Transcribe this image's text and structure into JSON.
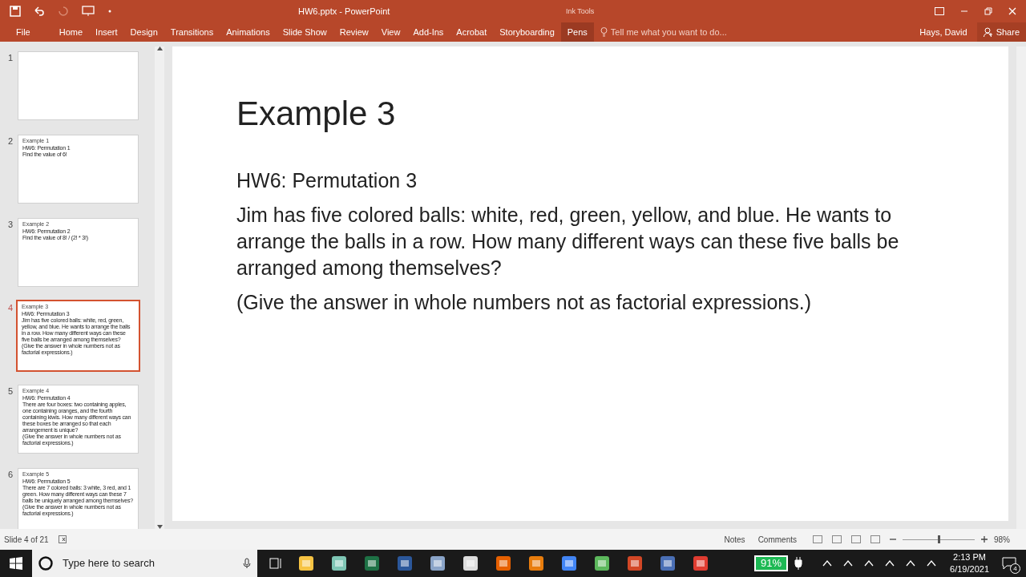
{
  "title_bar": {
    "title": "HW6.pptx - PowerPoint",
    "context_label": "Ink Tools"
  },
  "ribbon": {
    "tabs": [
      {
        "label": "File",
        "selected": false
      },
      {
        "label": "Home",
        "selected": false
      },
      {
        "label": "Insert",
        "selected": false
      },
      {
        "label": "Design",
        "selected": false
      },
      {
        "label": "Transitions",
        "selected": false
      },
      {
        "label": "Animations",
        "selected": false
      },
      {
        "label": "Slide Show",
        "selected": false
      },
      {
        "label": "Review",
        "selected": false
      },
      {
        "label": "View",
        "selected": false
      },
      {
        "label": "Add-Ins",
        "selected": false
      },
      {
        "label": "Acrobat",
        "selected": false
      },
      {
        "label": "Storyboarding",
        "selected": false
      },
      {
        "label": "Pens",
        "selected": true
      }
    ],
    "tell_me": "Tell me what you want to do...",
    "user": "Hays, David",
    "share": "Share"
  },
  "thumbnails": [
    {
      "number": "1",
      "selected": false
    },
    {
      "number": "2",
      "selected": false,
      "title": "Example 1",
      "lines": [
        "HW6: Permutation 1",
        "Find the value of 6!"
      ]
    },
    {
      "number": "3",
      "selected": false,
      "title": "Example 2",
      "lines": [
        "HW6: Permutation 2",
        "Find the value of 8! / (2! * 3!)"
      ]
    },
    {
      "number": "4",
      "selected": true,
      "title": "Example 3",
      "lines": [
        "HW6: Permutation 3",
        "Jim has five colored balls: white, red, green, yellow, and blue. He wants to arrange the balls in a row. How many different ways can these five balls be arranged among themselves?",
        "(Give the answer in whole numbers not as factorial expressions.)"
      ]
    },
    {
      "number": "5",
      "selected": false,
      "title": "Example 4",
      "lines": [
        "HW6: Permutation 4",
        "There are four boxes: two containing apples, one containing oranges, and the fourth containing kiwis. How many different ways can these boxes be arranged so that each arrangement is unique?",
        "(Give the answer in whole numbers not as factorial expressions.)"
      ]
    },
    {
      "number": "6",
      "selected": false,
      "title": "Example 5",
      "lines": [
        "HW6: Permutation 5",
        "There are 7 colored balls: 3 white, 3 red, and 1 green. How many different ways can these 7 balls be uniquely arranged among themselves?",
        "(Give the answer in whole numbers not as factorial expressions.)"
      ]
    }
  ],
  "slide": {
    "title": "Example 3",
    "paragraphs": [
      "HW6: Permutation 3",
      "Jim has five colored balls: white, red, green, yellow, and blue. He wants to arrange the balls in a row. How many different ways can these five balls be arranged among themselves?",
      "(Give the answer in whole numbers not as factorial expressions.)"
    ]
  },
  "status_bar": {
    "slide_info": "Slide 4 of 21",
    "notes": "Notes",
    "comments": "Comments",
    "zoom": {
      "level": 0.49,
      "reading": "98%"
    }
  },
  "taskbar": {
    "search_placeholder": "Type here to search",
    "battery": "91%",
    "time": "2:13 PM",
    "date": "6/19/2021",
    "notifications": "4"
  }
}
